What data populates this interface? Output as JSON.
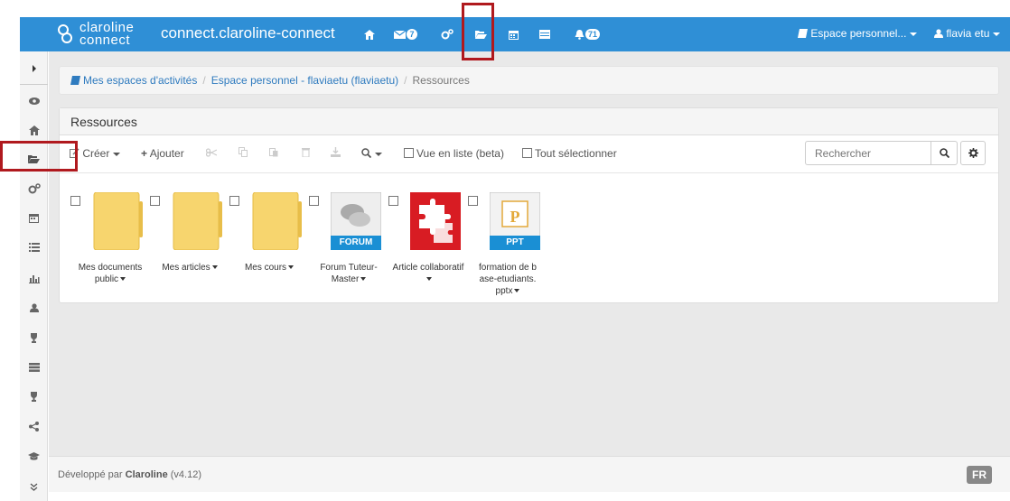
{
  "navbar": {
    "logo_line1": "claroline",
    "logo_line2": "connect",
    "brand": "connect.claroline-connect",
    "messages_badge": "7",
    "notifications_badge": "71",
    "workspace_menu": "Espace personnel...",
    "user_menu": "flavia etu"
  },
  "breadcrumb": {
    "items": [
      "Mes espaces d'activités",
      "Espace personnel - flaviaetu (flaviaetu)",
      "Ressources"
    ]
  },
  "panel": {
    "title": "Ressources"
  },
  "toolbar": {
    "create": "Créer",
    "add": "Ajouter",
    "list_view": "Vue en liste (beta)",
    "select_all": "Tout sélectionner",
    "search_placeholder": "Rechercher"
  },
  "resources": [
    {
      "type": "folder",
      "label": "Mes documents public"
    },
    {
      "type": "folder",
      "label": "Mes articles"
    },
    {
      "type": "folder",
      "label": "Mes cours"
    },
    {
      "type": "forum",
      "label": "Forum Tuteur-Master",
      "tag": "FORUM"
    },
    {
      "type": "collaborative",
      "label": "Article collaboratif"
    },
    {
      "type": "ppt",
      "label": "formation de base-etudiants.pptx",
      "tag": "PPT",
      "letter": "P"
    }
  ],
  "footer": {
    "prefix": "Développé par",
    "brand": "Claroline",
    "version": "(v4.12)",
    "language": "FR"
  },
  "colors": {
    "navbar": "#2f8fd6",
    "highlight": "#b0191e",
    "link": "#2f7bbf"
  }
}
